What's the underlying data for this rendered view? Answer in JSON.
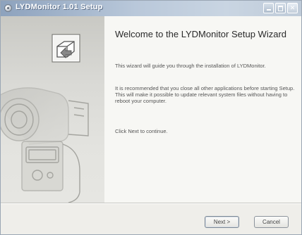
{
  "window": {
    "title": "LYDMonitor 1.01 Setup",
    "icons": {
      "app": "cd-disc-icon",
      "minimize": "minimize-icon",
      "maximize": "maximize-icon",
      "close": "close-icon"
    },
    "close_glyph": "✕"
  },
  "banner": {
    "logo_icon": "installer-box-icon",
    "illustration": "camera-illustration"
  },
  "content": {
    "heading": "Welcome to the LYDMonitor Setup Wizard",
    "paragraphs": [
      "This wizard will guide you through the installation of LYDMonitor.",
      "It is recommended that you close all other applications before starting Setup. This will make it possible to update relevant system files without having to reboot your computer.",
      "Click Next to continue."
    ]
  },
  "buttons": {
    "next_label": "Next >",
    "cancel_label": "Cancel"
  }
}
